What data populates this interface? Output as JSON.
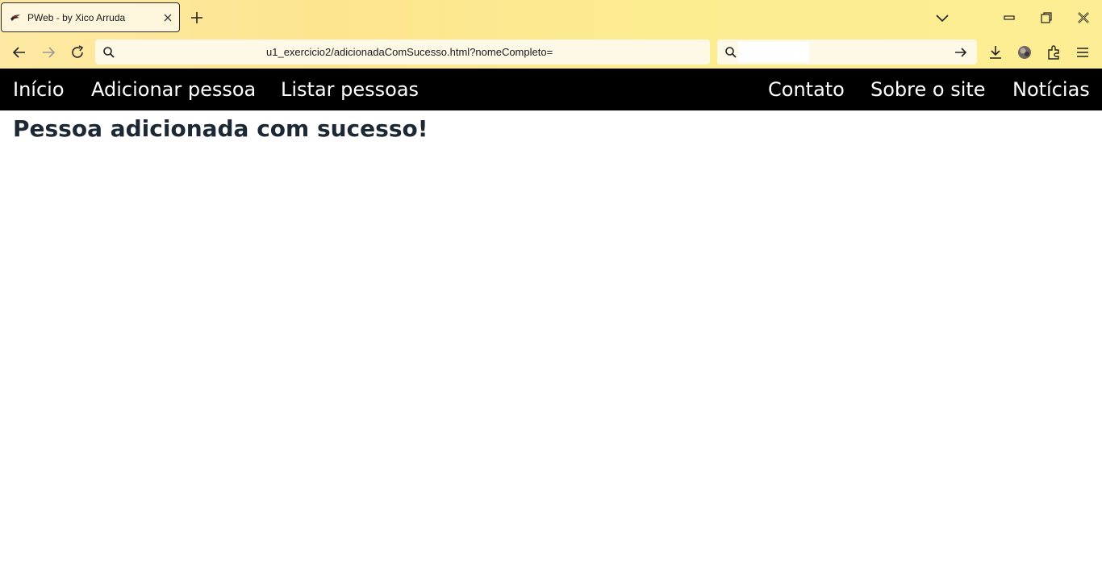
{
  "browser": {
    "tab": {
      "title": "PWeb - by Xico Arruda",
      "favicon": "dark-bird-icon"
    },
    "url": "u1_exercicio2/adicionadaComSucesso.html?nomeCompleto=",
    "search_placeholder": "",
    "accent": "#fde58f"
  },
  "site": {
    "nav_left": [
      "Início",
      "Adicionar pessoa",
      "Listar pessoas"
    ],
    "nav_right": [
      "Contato",
      "Sobre o site",
      "Notícias"
    ],
    "nav_background": "#000000",
    "heading": "Pessoa adicionada com sucesso!"
  }
}
